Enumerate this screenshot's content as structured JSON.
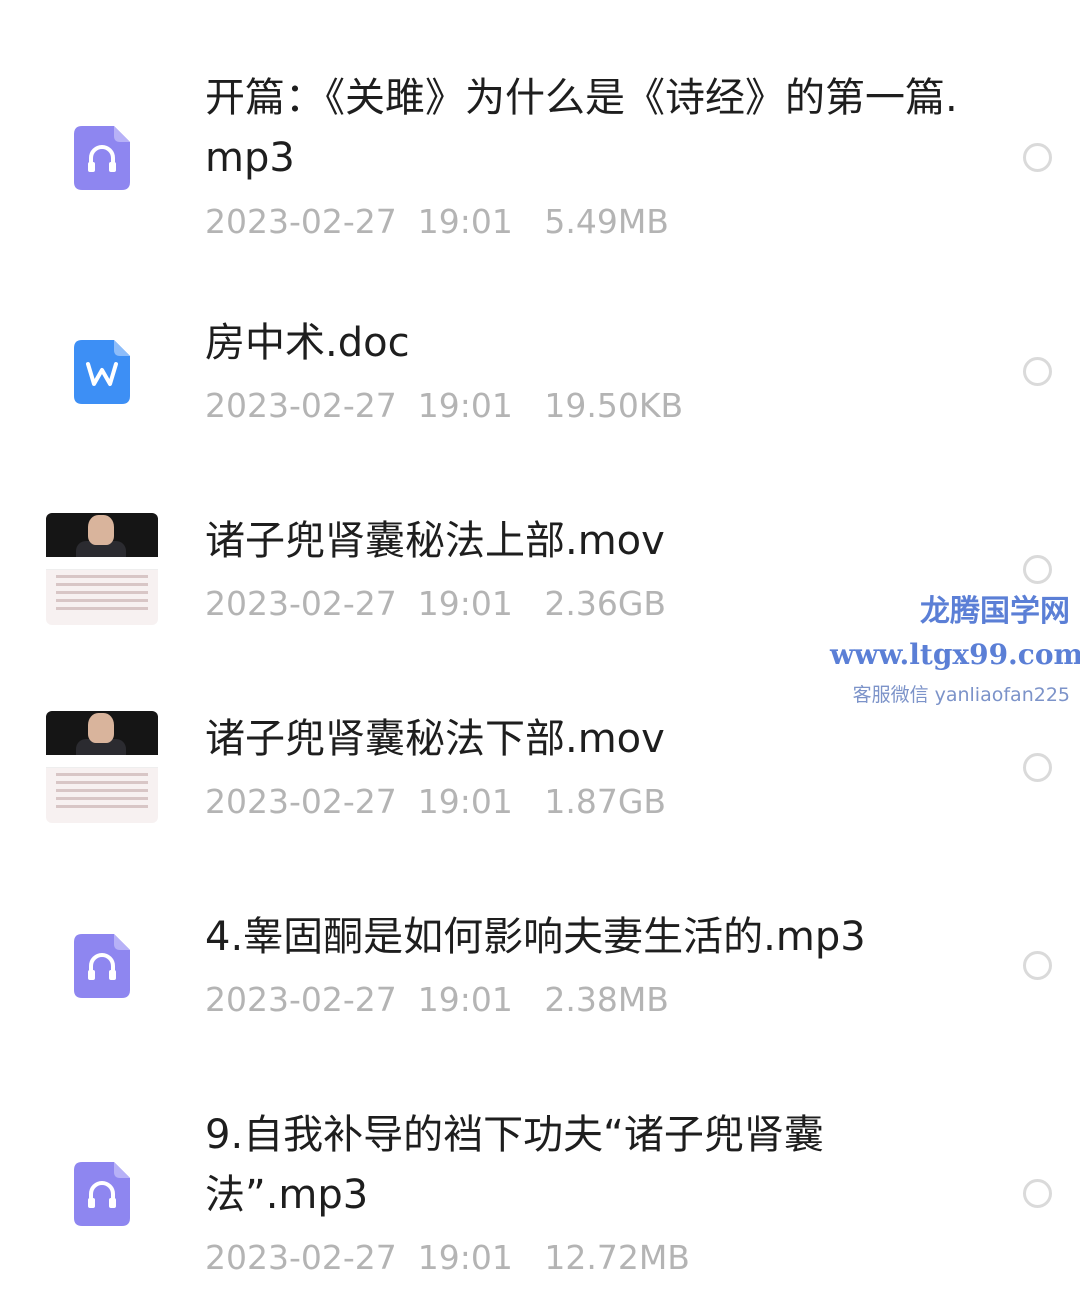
{
  "files": [
    {
      "name": "开篇：《关雎》为什么是《诗经》的第一篇.mp3",
      "date": "2023-02-27",
      "time": "19:01",
      "size": "5.49MB",
      "icon": "audio-file-icon"
    },
    {
      "name": "房中术.doc",
      "date": "2023-02-27",
      "time": "19:01",
      "size": "19.50KB",
      "icon": "word-file-icon"
    },
    {
      "name": "诸子兜肾囊秘法上部.mov",
      "date": "2023-02-27",
      "time": "19:01",
      "size": "2.36GB",
      "icon": "video-thumbnail"
    },
    {
      "name": "诸子兜肾囊秘法下部.mov",
      "date": "2023-02-27",
      "time": "19:01",
      "size": "1.87GB",
      "icon": "video-thumbnail"
    },
    {
      "name": "4.睾固酮是如何影响夫妻生活的.mp3",
      "date": "2023-02-27",
      "time": "19:01",
      "size": "2.38MB",
      "icon": "audio-file-icon"
    },
    {
      "name": "9.自我补导的裆下功夫“诸子兜肾囊法”.mp3",
      "date": "2023-02-27",
      "time": "19:01",
      "size": "12.72MB",
      "icon": "audio-file-icon"
    }
  ],
  "watermark": {
    "title": "龙腾国学网",
    "url": "www.ltgx99.com",
    "contact": "客服微信 yanliaofan225"
  },
  "colors": {
    "audio_icon": "#8e86f0",
    "word_icon": "#3d8ff5",
    "meta_text": "#b4b4b4",
    "watermark": "#5b7fd6"
  }
}
